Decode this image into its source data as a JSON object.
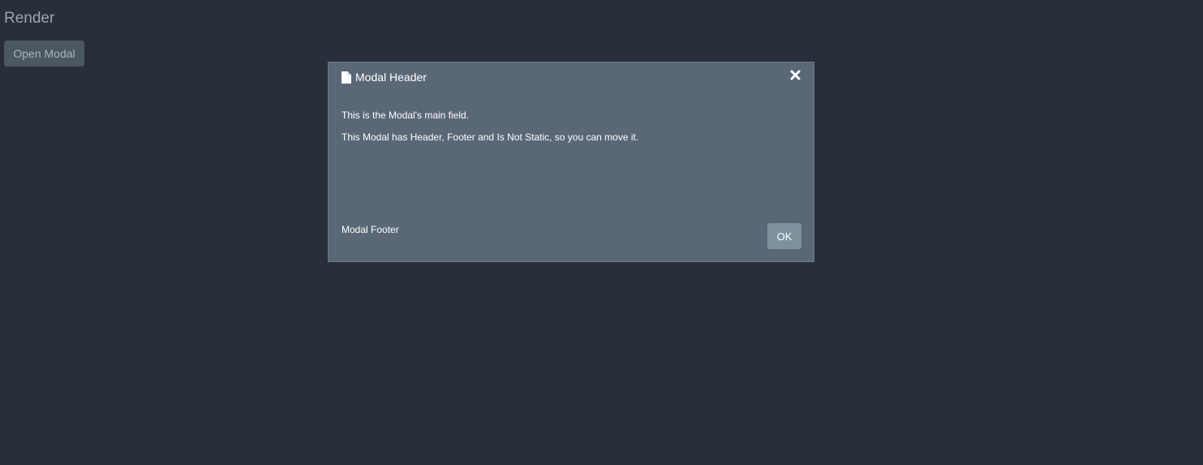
{
  "page": {
    "title": "Render",
    "open_button_label": "Open Modal"
  },
  "modal": {
    "header_icon": "document-icon",
    "title": "Modal Header",
    "close_icon": "close-icon",
    "body": [
      "This is the Modal's main field.",
      "This Modal has Header, Footer and Is Not Static, so you can move it."
    ],
    "footer_text": "Modal Footer",
    "ok_button_label": "OK"
  },
  "colors": {
    "background": "#282e3a",
    "modal_background": "#5a6777",
    "open_button": "#4b5761",
    "ok_button": "#7c929f"
  }
}
